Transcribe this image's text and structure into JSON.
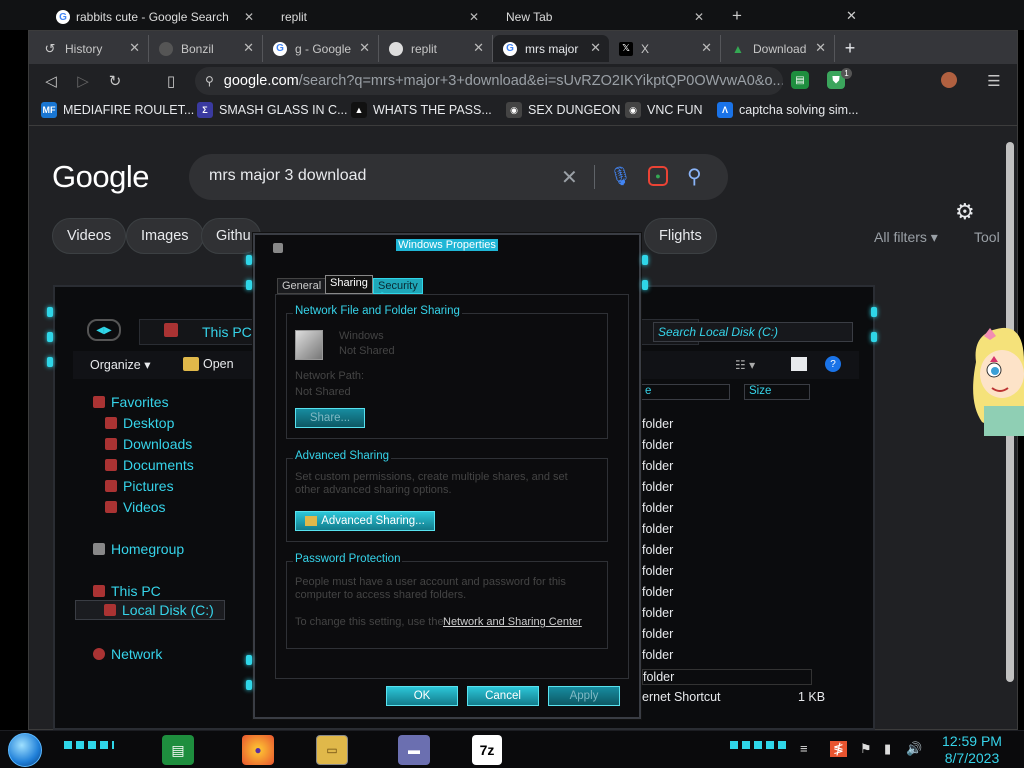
{
  "back_window": {
    "tabs": [
      {
        "label": "rabbits cute - Google Search"
      },
      {
        "label": "replit"
      },
      {
        "label": "New Tab"
      }
    ]
  },
  "browser": {
    "tabs": [
      {
        "label": "History",
        "icon": "history-icon"
      },
      {
        "label": "Bonzil",
        "icon": "bonzi-icon"
      },
      {
        "label": "g - Google",
        "icon": "google-icon"
      },
      {
        "label": "replit",
        "icon": "replit-icon"
      },
      {
        "label": "mrs major",
        "icon": "google-icon",
        "active": true
      },
      {
        "label": "X",
        "icon": "x-logo-icon"
      },
      {
        "label": "Download",
        "icon": "download-site-icon"
      }
    ],
    "new_tab": "+",
    "url_host": "google.com",
    "url_path": "/search?q=mrs+major+3+download&ei=sUvRZO2IKYikptQP0OWvwA0&o...",
    "extension_badge": "1",
    "bookmarks": [
      {
        "label": "MEDIAFIRE ROULET...",
        "icon_text": "MF"
      },
      {
        "label": "SMASH GLASS IN C...",
        "icon_text": "Σ"
      },
      {
        "label": "WHATS THE PASS...",
        "icon_text": "▲"
      },
      {
        "label": "SEX DUNGEON",
        "icon_text": "◉"
      },
      {
        "label": "VNC FUN",
        "icon_text": "◉"
      },
      {
        "label": "captcha solving sim...",
        "icon_text": "Λ"
      }
    ]
  },
  "google": {
    "logo": "Google",
    "query": "mrs major 3 download",
    "chips": [
      "Videos",
      "Images",
      "Githu",
      "Flights"
    ],
    "all_filters": "All filters ▾",
    "tools": "Tool"
  },
  "explorer": {
    "address": "This PC",
    "search_placeholder": "Search Local Disk (C:)",
    "organize": "Organize ▾",
    "open": "Open",
    "col_name": "e",
    "col_size": "Size",
    "nav": {
      "favorites": "Favorites",
      "desktop": "Desktop",
      "downloads": "Downloads",
      "documents": "Documents",
      "pictures": "Pictures",
      "videos": "Videos",
      "homegroup": "Homegroup",
      "this_pc": "This PC",
      "local_disk": "Local Disk (C:)",
      "network": "Network"
    },
    "rows": [
      "folder",
      "folder",
      "folder",
      "folder",
      "folder",
      "folder",
      "folder",
      "folder",
      "folder",
      "folder",
      "folder",
      "folder",
      "folder",
      "folder"
    ],
    "last_row_type": "ernet Shortcut",
    "last_row_size": "1 KB"
  },
  "dialog": {
    "title": "Windows Properties",
    "tabs": [
      "General",
      "Sharing",
      "Security"
    ],
    "network_sharing_title": "Network File and Folder Sharing",
    "item_name": "Windows",
    "item_status": "Not Shared",
    "network_path_label": "Network Path:",
    "network_path_value": "Not Shared",
    "share_button": "Share...",
    "advanced_title": "Advanced Sharing",
    "advanced_desc": "Set custom permissions, create multiple shares, and set other advanced sharing options.",
    "advanced_button": "Advanced Sharing...",
    "password_title": "Password Protection",
    "password_desc": "People must have a user account and password for this computer to access shared folders.",
    "password_change_prefix": "To change this setting, use the",
    "password_link": "Network and Sharing Center",
    "ok": "OK",
    "cancel": "Cancel",
    "apply": "Apply"
  },
  "taskbar": {
    "time": "12:59 PM",
    "date": "8/7/2023"
  },
  "colors": {
    "accent_cyan": "#2fd6e8",
    "chrome_bg": "#202124",
    "dialog_button": "#1fa7b9"
  }
}
